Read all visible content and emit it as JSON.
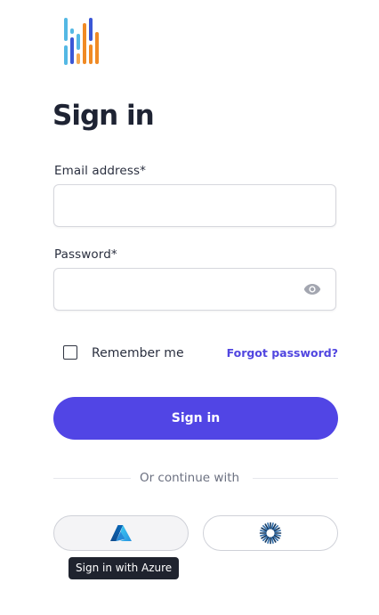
{
  "logo": {
    "icon": "bars-logo-icon"
  },
  "heading": "Sign in",
  "email": {
    "label": "Email address",
    "required_mark": "*",
    "value": "",
    "placeholder": ""
  },
  "password": {
    "label": "Password",
    "required_mark": "*",
    "value": "",
    "placeholder": "",
    "toggle_icon": "eye-icon"
  },
  "remember": {
    "label": "Remember me",
    "checked": false
  },
  "forgot_link": "Forgot password?",
  "submit_label": "Sign in",
  "divider_text": "Or continue with",
  "sso": [
    {
      "provider": "Azure",
      "icon": "azure-icon"
    },
    {
      "provider": "Other",
      "icon": "sunburst-icon"
    }
  ],
  "tooltip": "Sign in with Azure",
  "colors": {
    "primary": "#5145e5",
    "link": "#5146e0",
    "logo_blue": "#54b8e4",
    "logo_navy": "#3a57d6",
    "logo_orange": "#f08a24",
    "logo_light_orange": "#f5a94f"
  }
}
